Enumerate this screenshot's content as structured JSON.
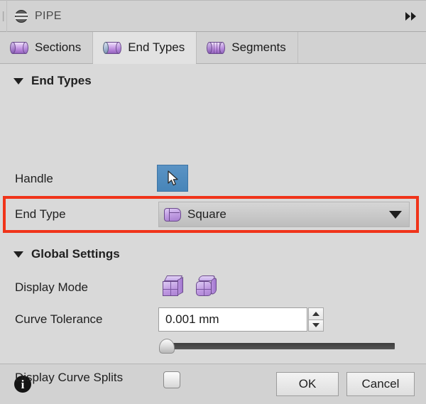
{
  "window": {
    "title": "PIPE",
    "pipe_icon": "pipe-icon",
    "grip": "drag-grip",
    "expand_icon": "double-chevron-right-icon"
  },
  "tabs": [
    {
      "label": "Sections",
      "icon": "cylinder-sections-icon",
      "active": false
    },
    {
      "label": "End Types",
      "icon": "cylinder-end-types-icon",
      "active": true
    },
    {
      "label": "Segments",
      "icon": "cylinder-segments-icon",
      "active": false
    }
  ],
  "sections": {
    "end_types": {
      "title": "End Types",
      "caret": "caret-down-icon",
      "handle": {
        "label": "Handle",
        "button_icon": "arrow-cursor-icon"
      },
      "end_type": {
        "label": "End Type",
        "value": "Square",
        "value_icon": "square-end-icon",
        "arrow_icon": "chevron-down-icon",
        "highlight_color": "#f0341a"
      }
    },
    "global_settings": {
      "title": "Global Settings",
      "caret": "caret-down-icon",
      "display_mode": {
        "label": "Display Mode",
        "option_sharp_icon": "cube-sharp-icon",
        "option_round_icon": "cube-rounded-icon"
      },
      "curve_tolerance": {
        "label": "Curve Tolerance",
        "value": "0.001 mm",
        "spin_up_icon": "spinner-up-icon",
        "spin_down_icon": "spinner-down-icon",
        "slider_position_percent": 0
      },
      "display_curve_splits": {
        "label": "Display Curve Splits",
        "checked": false
      }
    }
  },
  "footer": {
    "info_icon": "info-icon",
    "info_glyph": "i",
    "ok_label": "OK",
    "cancel_label": "Cancel"
  }
}
